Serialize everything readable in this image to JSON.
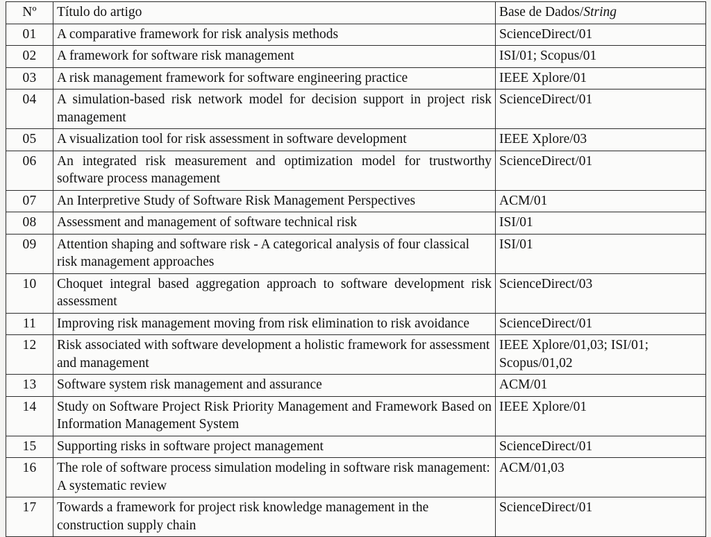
{
  "table": {
    "headers": {
      "num": "Nº",
      "title": "Título do artigo",
      "base_plain": "Base de Dados/",
      "base_italic": "String"
    },
    "rows": [
      {
        "num": "01",
        "title": "A comparative framework for risk analysis methods",
        "base": "ScienceDirect/01",
        "multiline": false,
        "justified": false
      },
      {
        "num": "02",
        "title": "A framework for software risk management",
        "base": "ISI/01; Scopus/01",
        "multiline": false,
        "justified": false
      },
      {
        "num": "03",
        "title": "A risk management framework for software engineering practice",
        "base": "IEEE Xplore/01",
        "multiline": false,
        "justified": false
      },
      {
        "num": "04",
        "title": "A simulation-based risk network model for decision support in project risk management",
        "base": "ScienceDirect/01",
        "multiline": true,
        "justified": true
      },
      {
        "num": "05",
        "title": "A visualization tool for risk assessment in software development",
        "base": "IEEE Xplore/03",
        "multiline": false,
        "justified": false
      },
      {
        "num": "06",
        "title": "An integrated risk measurement and optimization model for trustworthy software process management",
        "base": "ScienceDirect/01",
        "multiline": true,
        "justified": true
      },
      {
        "num": "07",
        "title": "An Interpretive Study of Software Risk Management Perspectives",
        "base": "ACM/01",
        "multiline": false,
        "justified": false
      },
      {
        "num": "08",
        "title": "Assessment and management of software technical risk",
        "base": "ISI/01",
        "multiline": false,
        "justified": false
      },
      {
        "num": "09",
        "title": "Attention shaping and software risk - A categorical analysis of four classical risk management approaches",
        "base": "ISI/01",
        "multiline": true,
        "justified": false
      },
      {
        "num": "10",
        "title": "Choquet integral based aggregation approach to software development risk assessment",
        "base": "ScienceDirect/03",
        "multiline": true,
        "justified": true
      },
      {
        "num": "11",
        "title": "Improving risk management moving from risk elimination to risk avoidance",
        "base": "ScienceDirect/01",
        "multiline": true,
        "justified": false
      },
      {
        "num": "12",
        "title": "Risk associated with software development a holistic framework for assessment and management",
        "base": "IEEE Xplore/01,03; ISI/01; Scopus/01,02",
        "multiline": true,
        "justified": false
      },
      {
        "num": "13",
        "title": "Software system risk management and assurance",
        "base": "ACM/01",
        "multiline": false,
        "justified": false
      },
      {
        "num": "14",
        "title": "Study on Software Project Risk Priority Management and Framework Based on Information Management System",
        "base": "IEEE Xplore/01",
        "multiline": true,
        "justified": true
      },
      {
        "num": "15",
        "title": "Supporting risks in software project management",
        "base": "ScienceDirect/01",
        "multiline": false,
        "justified": false
      },
      {
        "num": "16",
        "title": "The role of software process simulation modeling in software risk management: A systematic review",
        "base": "ACM/01,03",
        "multiline": true,
        "justified": false
      },
      {
        "num": "17",
        "title": "Towards a framework for project risk knowledge management in the construction supply chain",
        "base": "ScienceDirect/01",
        "multiline": true,
        "justified": false
      }
    ]
  },
  "colors": {
    "page_background": "#f4f4f2",
    "cell_background": "#fbfbfa",
    "border": "#2b2b2b",
    "text": "#111111"
  }
}
